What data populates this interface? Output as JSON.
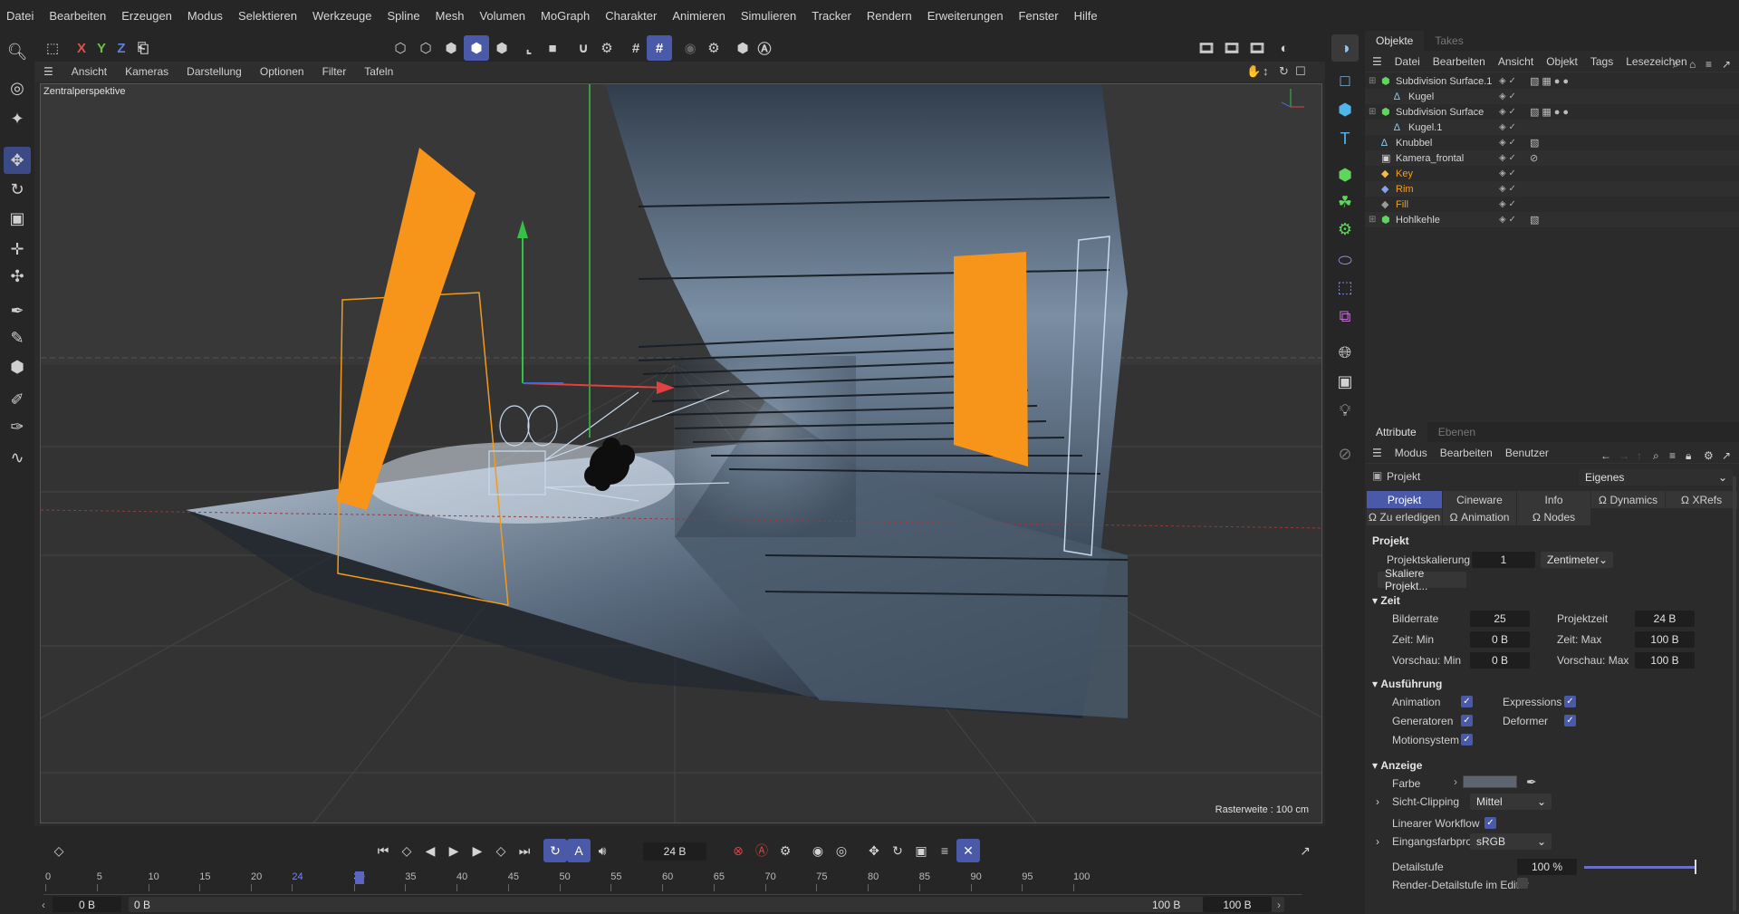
{
  "menu": [
    "Datei",
    "Bearbeiten",
    "Erzeugen",
    "Modus",
    "Selektieren",
    "Werkzeuge",
    "Spline",
    "Mesh",
    "Volumen",
    "MoGraph",
    "Charakter",
    "Animieren",
    "Simulieren",
    "Tracker",
    "Rendern",
    "Erweiterungen",
    "Fenster",
    "Hilfe"
  ],
  "axis_buttons": {
    "x": "X",
    "y": "Y",
    "z": "Z"
  },
  "viewport_menu": [
    "Ansicht",
    "Kameras",
    "Darstellung",
    "Optionen",
    "Filter",
    "Tafeln"
  ],
  "viewport": {
    "camera_label": "Zentralperspektive",
    "grid_label": "Rasterweite : 100 cm"
  },
  "objects_panel": {
    "tabs": [
      "Objekte",
      "Takes"
    ],
    "menu": [
      "Datei",
      "Bearbeiten",
      "Ansicht",
      "Objekt",
      "Tags",
      "Lesezeichen"
    ],
    "rows": [
      {
        "name": "Subdivision Surface.1",
        "color": "#d4d4d4"
      },
      {
        "name": "Kugel",
        "color": "#d4d4d4"
      },
      {
        "name": "Subdivision Surface",
        "color": "#d4d4d4"
      },
      {
        "name": "Kugel.1",
        "color": "#d4d4d4"
      },
      {
        "name": "Knubbel",
        "color": "#d4d4d4"
      },
      {
        "name": "Kamera_frontal",
        "color": "#d4d4d4"
      },
      {
        "name": "Key",
        "color": "#f0a020"
      },
      {
        "name": "Rim",
        "color": "#f0a020"
      },
      {
        "name": "Fill",
        "color": "#f0a020"
      },
      {
        "name": "Hohlkehle",
        "color": "#d4d4d4"
      }
    ]
  },
  "attr_panel": {
    "tabs": [
      "Attribute",
      "Ebenen"
    ],
    "menu": [
      "Modus",
      "Bearbeiten",
      "Benutzer"
    ],
    "object": "Projekt",
    "preset": "Eigenes",
    "subtabs_row1": [
      "Projekt",
      "Cineware",
      "Info",
      "Dynamics",
      "XRefs"
    ],
    "subtabs_row2": [
      "Zu erledigen",
      "Animation",
      "Nodes"
    ],
    "section_title": "Projekt",
    "projektskalierung_label": "Projektskalierung",
    "projektskalierung_value": "1",
    "projektskalierung_unit": "Zentimeter",
    "skaliere_button": "Skaliere Projekt...",
    "zeit_section": "Zeit",
    "bilderrate_label": "Bilderrate",
    "bilderrate_value": "25",
    "projektzeit_label": "Projektzeit",
    "projektzeit_value": "24 B",
    "zeit_min_label": "Zeit: Min",
    "zeit_min_value": "0 B",
    "zeit_max_label": "Zeit: Max",
    "zeit_max_value": "100 B",
    "vorschau_min_label": "Vorschau: Min",
    "vorschau_min_value": "0 B",
    "vorschau_max_label": "Vorschau: Max",
    "vorschau_max_value": "100 B",
    "ausfuehrung_section": "Ausführung",
    "animation_label": "Animation",
    "expressions_label": "Expressions",
    "generatoren_label": "Generatoren",
    "deformer_label": "Deformer",
    "motionsystem_label": "Motionsystem",
    "anzeige_section": "Anzeige",
    "farbe_label": "Farbe",
    "sicht_clipping_label": "Sicht-Clipping",
    "sicht_clipping_value": "Mittel",
    "linearer_workflow_label": "Linearer Workflow",
    "eingangsfarbprofil_label": "Eingangsfarbprofil",
    "eingangsfarbprofil_value": "sRGB",
    "detailstufe_label": "Detailstufe",
    "detailstufe_value": "100 %",
    "render_detail_label": "Render-Detailstufe im Editor"
  },
  "timeline": {
    "current_frame": "24 B",
    "ticks": [
      "0",
      "5",
      "10",
      "15",
      "20",
      "24",
      "30",
      "35",
      "40",
      "45",
      "50",
      "55",
      "60",
      "65",
      "70",
      "75",
      "80",
      "85",
      "90",
      "95",
      "100"
    ],
    "start_left": "0 B",
    "start_right": "0 B",
    "end_left": "100 B",
    "end_right": "100 B"
  }
}
